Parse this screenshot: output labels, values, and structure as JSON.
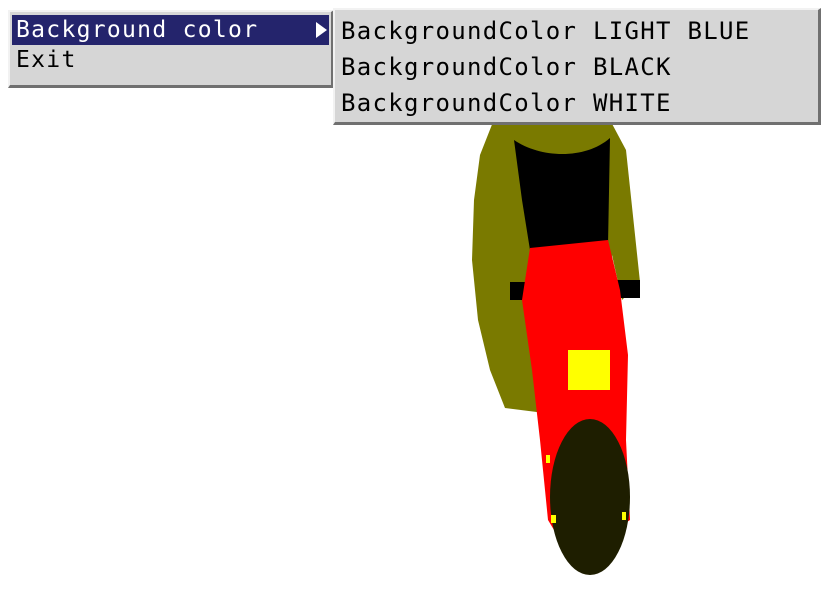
{
  "main_menu": {
    "items": [
      {
        "label": "Background color",
        "has_submenu": true,
        "highlighted": true
      },
      {
        "label": "Exit",
        "has_submenu": false,
        "highlighted": false
      }
    ]
  },
  "submenu": {
    "items": [
      {
        "label": "BackgroundColor LIGHT BLUE"
      },
      {
        "label": "BackgroundColor BLACK"
      },
      {
        "label": "BackgroundColor WHITE"
      }
    ]
  },
  "scene": {
    "background": "#ffffff",
    "colors": {
      "jacket": "#7a7a00",
      "shoulders": "#000000",
      "bike_body": "#ff0000",
      "light": "#ffff00",
      "tire": "#1e1e00",
      "highlight": "#ffff00"
    }
  },
  "icons": {
    "submenu_arrow": "triangle-right-icon"
  }
}
